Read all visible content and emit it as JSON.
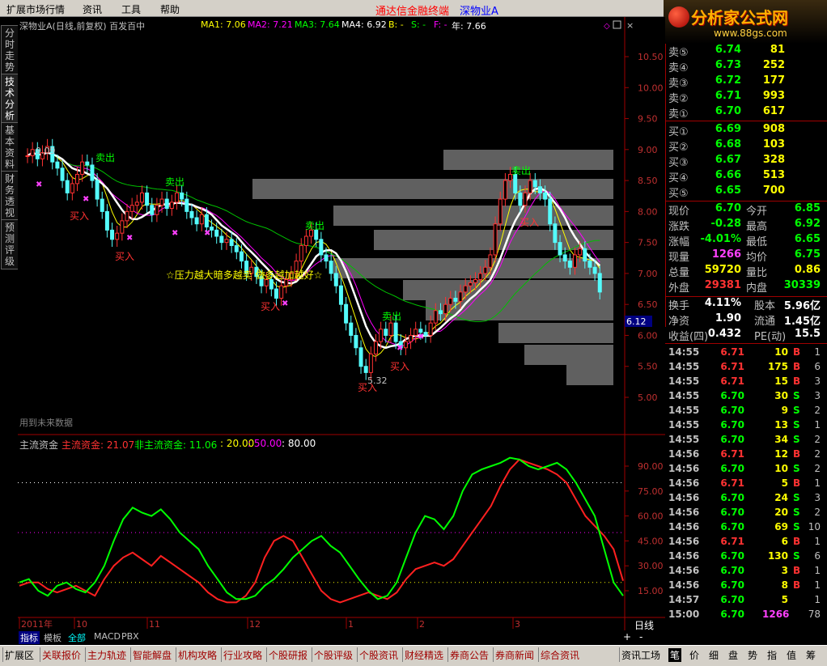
{
  "menu": {
    "items": [
      "扩展市场行情",
      "资讯",
      "工具",
      "帮助"
    ],
    "brand": "通达信金融终端",
    "stock": "深物业A"
  },
  "logo": {
    "title": "分析家公式网",
    "url": "www.88gs.com"
  },
  "left_tabs": [
    "分时走势",
    "技术分析",
    "基本资料",
    "财务透视",
    "预测评级"
  ],
  "main_chart": {
    "title": "深物业A(日线,前复权) 百发百中",
    "ma1": "MA1: 7.06",
    "ma2": "MA2: 7.21",
    "ma3": "MA3: 7.64",
    "ma4": "MA4: 6.92",
    "b": "B: -",
    "s": "S: -",
    "f": "F: -",
    "year": "年: 7.66",
    "price_axis": [
      "10.50",
      "10.00",
      "9.50",
      "9.00",
      "8.50",
      "8.00",
      "7.50",
      "7.00",
      "6.50",
      "6.00",
      "5.50",
      "5.00"
    ],
    "current_price_tag": "6.12",
    "high_label": "9.09",
    "low_label": "5.32",
    "buy_label": "买入",
    "sell_label": "卖出",
    "note": "☆压力越大暗多越卖 做多越加越好☆",
    "future_data": "用到未来数据",
    "colors": {
      "up": "#ff3232",
      "down": "#54fcfc",
      "ma_white": "#ffffff",
      "ma_yellow": "#ffff00",
      "ma_magenta": "#ff00ff",
      "ma_green": "#00c000"
    }
  },
  "indicator": {
    "name": "主流资金",
    "main": "主流资金: 21.07",
    "nonmain": "非主流资金: 11.06",
    "l1": ": 20.00",
    "l2": ": 50.00",
    "l3": ": 80.00",
    "axis": [
      "90.00",
      "75.00",
      "60.00",
      "45.00",
      "30.00",
      "15.00"
    ]
  },
  "time_axis": [
    "2011年",
    "10",
    "11",
    "12",
    "1",
    "2",
    "3"
  ],
  "period": "日线",
  "sell_levels": [
    {
      "label": "卖⑤",
      "price": "6.74",
      "vol": "81"
    },
    {
      "label": "卖④",
      "price": "6.73",
      "vol": "252"
    },
    {
      "label": "卖③",
      "price": "6.72",
      "vol": "177"
    },
    {
      "label": "卖②",
      "price": "6.71",
      "vol": "993"
    },
    {
      "label": "卖①",
      "price": "6.70",
      "vol": "617"
    }
  ],
  "buy_levels": [
    {
      "label": "买①",
      "price": "6.69",
      "vol": "908"
    },
    {
      "label": "买②",
      "price": "6.68",
      "vol": "103"
    },
    {
      "label": "买③",
      "price": "6.67",
      "vol": "328"
    },
    {
      "label": "买④",
      "price": "6.66",
      "vol": "513"
    },
    {
      "label": "买⑤",
      "price": "6.65",
      "vol": "700"
    }
  ],
  "stats": [
    {
      "l1": "现价",
      "v1": "6.70",
      "c1": "#00ff00",
      "l2": "今开",
      "v2": "6.85",
      "c2": "#00ff00"
    },
    {
      "l1": "涨跌",
      "v1": "-0.28",
      "c1": "#00ff00",
      "l2": "最高",
      "v2": "6.92",
      "c2": "#00ff00"
    },
    {
      "l1": "涨幅",
      "v1": "-4.01%",
      "c1": "#00ff00",
      "l2": "最低",
      "v2": "6.65",
      "c2": "#00ff00"
    },
    {
      "l1": "现量",
      "v1": "1266",
      "c1": "#ff40ff",
      "l2": "均价",
      "v2": "6.75",
      "c2": "#00ff00"
    },
    {
      "l1": "总量",
      "v1": "59720",
      "c1": "#ffff00",
      "l2": "量比",
      "v2": "0.86",
      "c2": "#ffff00"
    },
    {
      "l1": "外盘",
      "v1": "29381",
      "c1": "#ff3232",
      "l2": "内盘",
      "v2": "30339",
      "c2": "#00ff00"
    }
  ],
  "stats2": [
    {
      "l1": "换手",
      "v1": "4.11%",
      "l2": "股本",
      "v2": "5.96亿"
    },
    {
      "l1": "净资",
      "v1": "1.90",
      "l2": "流通",
      "v2": "1.45亿"
    },
    {
      "l1": "收益(四)",
      "v1": "0.432",
      "l2": "PE(动)",
      "v2": "15.5"
    }
  ],
  "ticks": [
    {
      "t": "14:55",
      "p": "6.71",
      "v": "10",
      "bs": "B",
      "n": "1"
    },
    {
      "t": "14:55",
      "p": "6.71",
      "v": "175",
      "bs": "B",
      "n": "6"
    },
    {
      "t": "14:55",
      "p": "6.71",
      "v": "15",
      "bs": "B",
      "n": "3"
    },
    {
      "t": "14:55",
      "p": "6.70",
      "v": "30",
      "bs": "S",
      "n": "3"
    },
    {
      "t": "14:55",
      "p": "6.70",
      "v": "9",
      "bs": "S",
      "n": "2"
    },
    {
      "t": "14:55",
      "p": "6.70",
      "v": "13",
      "bs": "S",
      "n": "1"
    },
    {
      "t": "14:55",
      "p": "6.70",
      "v": "34",
      "bs": "S",
      "n": "2"
    },
    {
      "t": "14:56",
      "p": "6.71",
      "v": "12",
      "bs": "B",
      "n": "2"
    },
    {
      "t": "14:56",
      "p": "6.70",
      "v": "10",
      "bs": "S",
      "n": "2"
    },
    {
      "t": "14:56",
      "p": "6.71",
      "v": "5",
      "bs": "B",
      "n": "1"
    },
    {
      "t": "14:56",
      "p": "6.70",
      "v": "24",
      "bs": "S",
      "n": "3"
    },
    {
      "t": "14:56",
      "p": "6.70",
      "v": "20",
      "bs": "S",
      "n": "2"
    },
    {
      "t": "14:56",
      "p": "6.70",
      "v": "69",
      "bs": "S",
      "n": "10"
    },
    {
      "t": "14:56",
      "p": "6.71",
      "v": "6",
      "bs": "B",
      "n": "1"
    },
    {
      "t": "14:56",
      "p": "6.70",
      "v": "130",
      "bs": "S",
      "n": "6"
    },
    {
      "t": "14:56",
      "p": "6.70",
      "v": "3",
      "bs": "B",
      "n": "1"
    },
    {
      "t": "14:56",
      "p": "6.70",
      "v": "8",
      "bs": "B",
      "n": "1"
    },
    {
      "t": "14:57",
      "p": "6.70",
      "v": "5",
      "bs": "",
      "n": "1"
    },
    {
      "t": "15:00",
      "p": "6.70",
      "v": "1266",
      "bs": "",
      "n": "78"
    }
  ],
  "bottom_small_tabs": [
    "指标",
    "模板",
    "全部",
    "MACD",
    "PBX"
  ],
  "bottom_tabs": [
    "扩展区",
    "关联报价",
    "主力轨迹",
    "智能解盘",
    "机构攻略",
    "行业攻略",
    "个股研报",
    "个股评级",
    "个股资讯",
    "财经精选",
    "券商公告",
    "券商新闻",
    "综合资讯",
    "资讯工场"
  ],
  "right_bottom_tabs": [
    "笔",
    "价",
    "细",
    "盘",
    "势",
    "指",
    "值",
    "筹"
  ],
  "stepper": {
    "minus": "+",
    "plus": "-"
  }
}
